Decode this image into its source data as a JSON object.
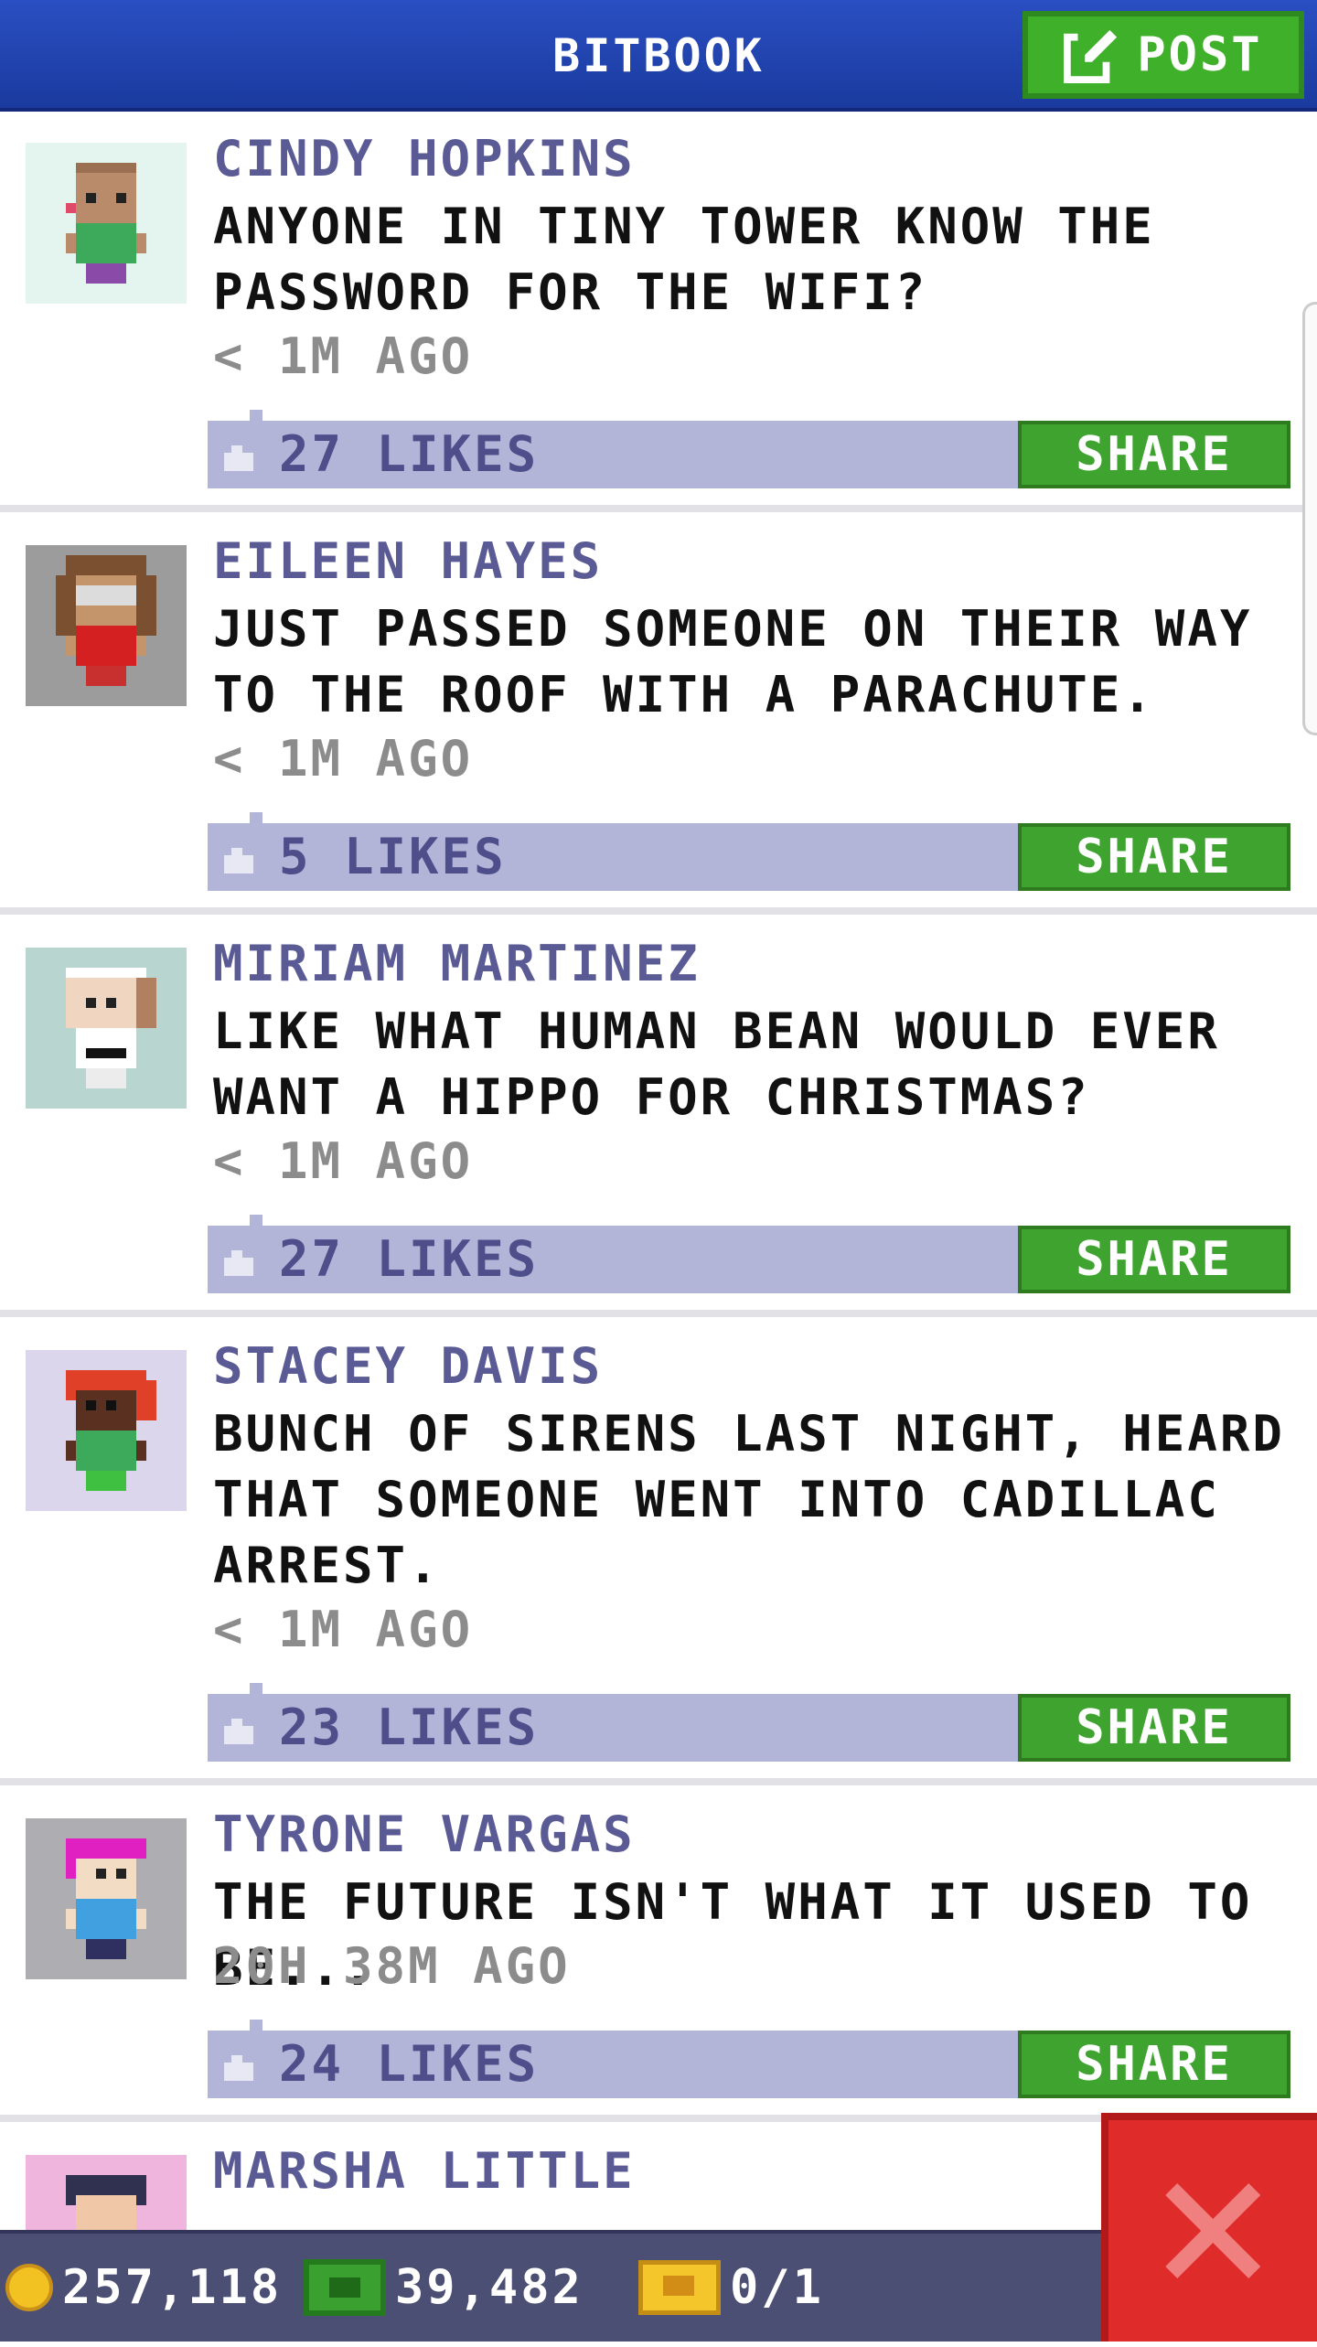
{
  "header": {
    "title": "BITBOOK",
    "post_label": "POST"
  },
  "posts": [
    {
      "name": "CINDY HOPKINS",
      "message": "ANYONE IN TINY TOWER KNOW THE\nPASSWORD FOR THE WIFI?",
      "time": "< 1M AGO",
      "likes": "27 LIKES",
      "share": "SHARE",
      "avatar_bg": "#e3f5ee"
    },
    {
      "name": "EILEEN HAYES",
      "message": "JUST PASSED SOMEONE ON THEIR WAY\nTO THE ROOF WITH A PARACHUTE.",
      "time": "< 1M AGO",
      "likes": "5 LIKES",
      "share": "SHARE",
      "avatar_bg": "#9c9c9c"
    },
    {
      "name": "MIRIAM MARTINEZ",
      "message": "LIKE WHAT HUMAN BEAN WOULD EVER\nWANT A HIPPO FOR CHRISTMAS?",
      "time": "< 1M AGO",
      "likes": "27 LIKES",
      "share": "SHARE",
      "avatar_bg": "#b8d6cf"
    },
    {
      "name": "STACEY DAVIS",
      "message": "BUNCH OF SIRENS LAST NIGHT, HEARD\nTHAT SOMEONE WENT INTO CADILLAC\nARREST.",
      "time": "< 1M AGO",
      "likes": "23 LIKES",
      "share": "SHARE",
      "avatar_bg": "#dcd6ec"
    },
    {
      "name": "TYRONE VARGAS",
      "message": "THE FUTURE ISN'T WHAT IT USED TO BE...",
      "time": "20H 38M AGO",
      "likes": "24 LIKES",
      "share": "SHARE",
      "avatar_bg": "#adadb2"
    },
    {
      "name": "MARSHA LITTLE",
      "message": "",
      "avatar_bg": "#f0b5dd"
    }
  ],
  "status": {
    "coins": "257,118",
    "bux": "39,482",
    "vip": "0/1"
  },
  "colors": {
    "header_blue": "#2a4fc2",
    "share_green": "#3fa32f",
    "like_bar": "#b3b5d8",
    "name_purple": "#5a5a95",
    "close_red": "#e02b2b"
  }
}
